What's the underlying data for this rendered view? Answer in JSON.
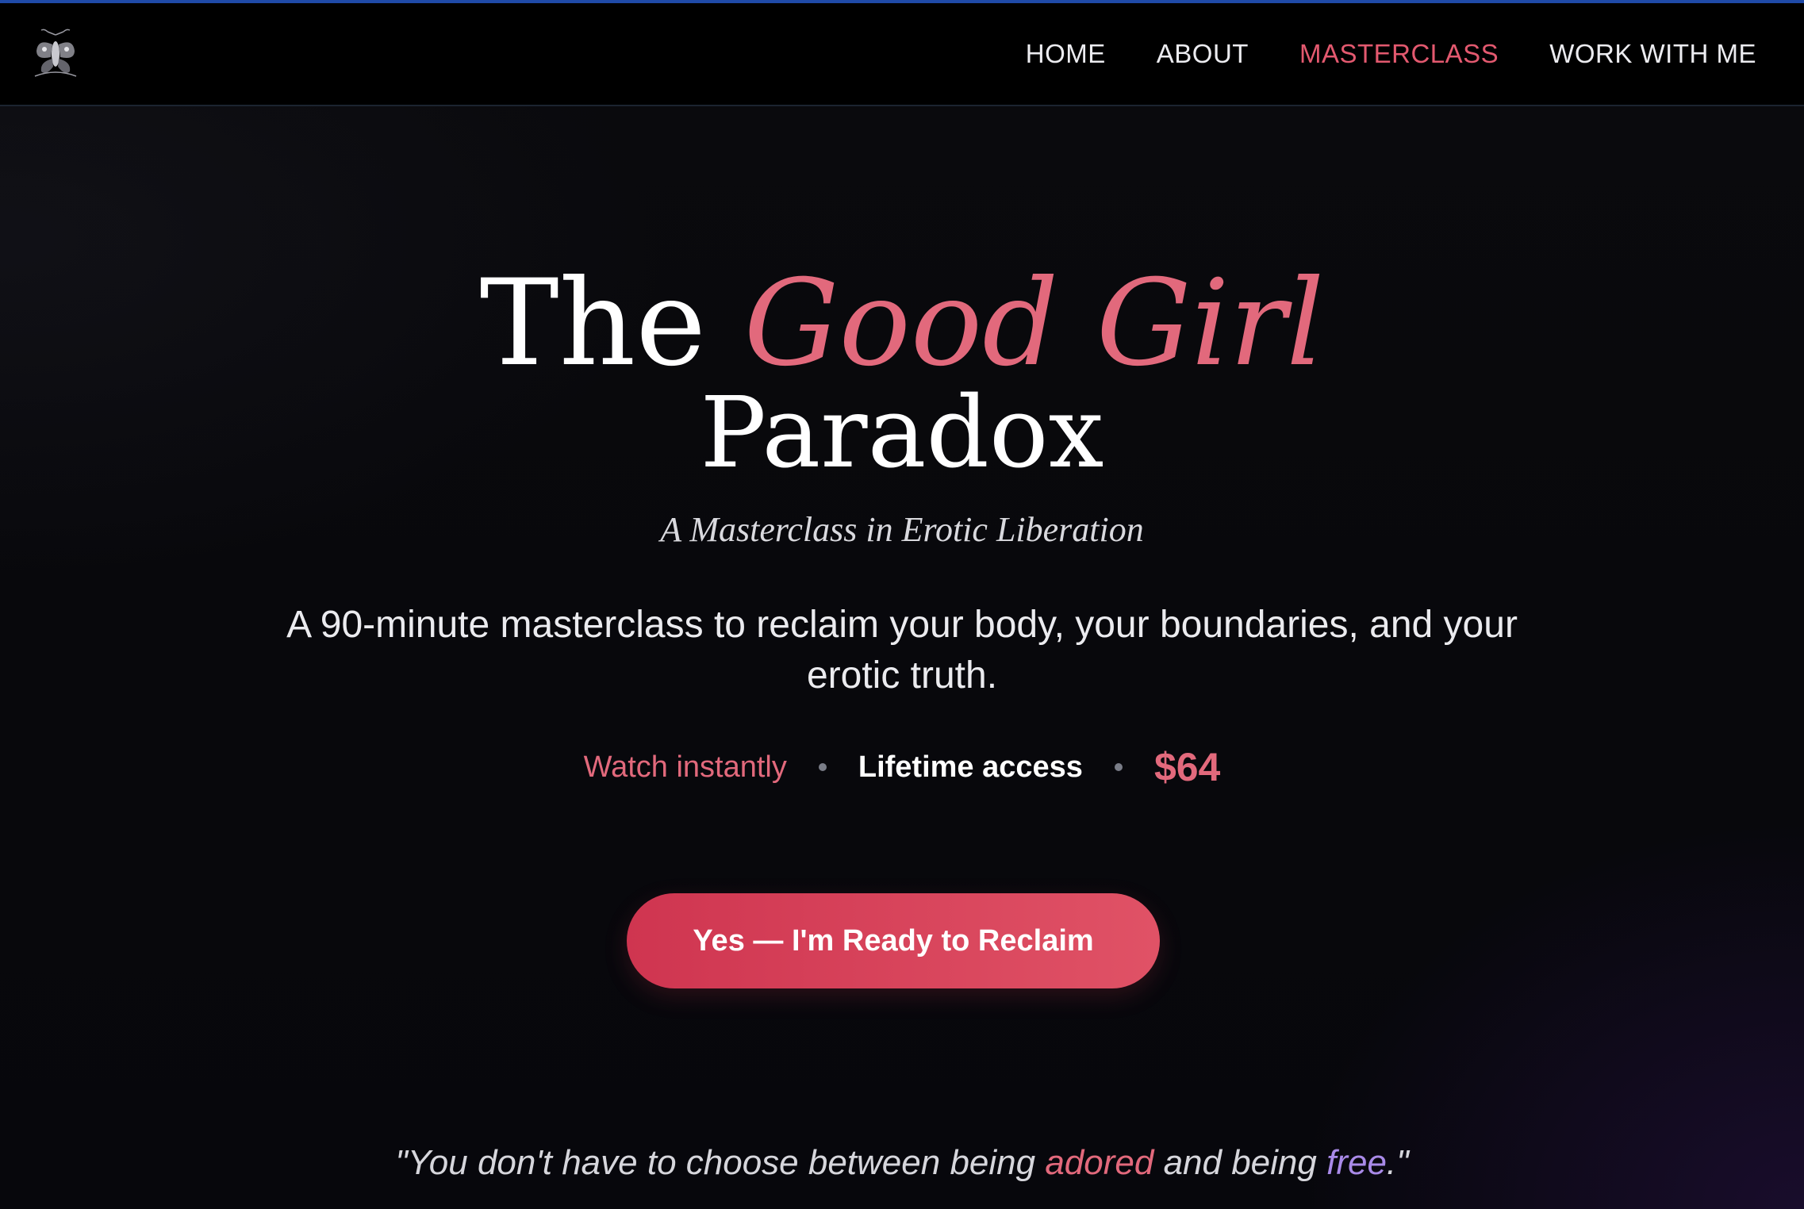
{
  "nav": {
    "logo_icon": "moth-emblem-icon",
    "items": [
      {
        "label": "HOME",
        "active": false
      },
      {
        "label": "ABOUT",
        "active": false
      },
      {
        "label": "MASTERCLASS",
        "active": true
      },
      {
        "label": "WORK WITH ME",
        "active": false
      }
    ]
  },
  "hero": {
    "title_prefix": "The",
    "title_accent": "Good Girl",
    "title_line2": "Paradox",
    "subtitle": "A Masterclass in Erotic Liberation",
    "description": "A 90-minute masterclass to reclaim your body, your boundaries, and your erotic truth.",
    "meta": {
      "watch": "Watch instantly",
      "access": "Lifetime access",
      "price": "$64"
    },
    "cta_label": "Yes — I'm Ready to Reclaim"
  },
  "quote": {
    "part1": "\"You don't have to choose between being ",
    "word1": "adored",
    "part2": " and being ",
    "word2": "free",
    "part3": ".\""
  },
  "colors": {
    "accent_pink": "#e2697c",
    "nav_active": "#e3596f",
    "cta_start": "#cf3550",
    "cta_end": "#e05266",
    "quote_purple": "#a98ae8",
    "top_accent_bar": "#1f4aa8",
    "background": "#07070b"
  }
}
